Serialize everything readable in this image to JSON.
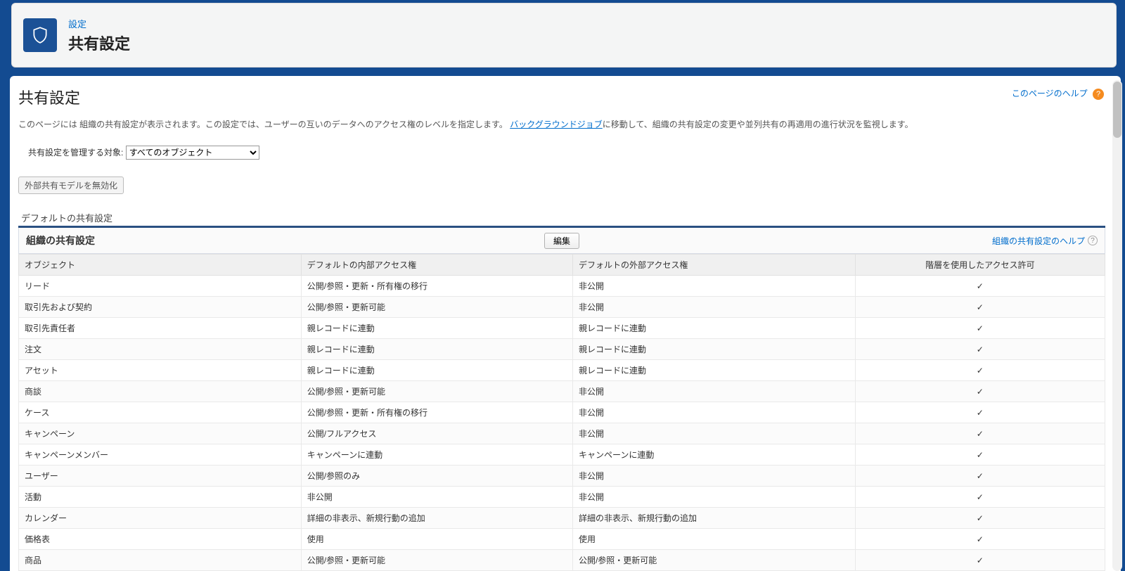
{
  "breadcrumb": "設定",
  "page_title": "共有設定",
  "content": {
    "heading": "共有設定",
    "help_link": "このページのヘルプ",
    "description_prefix": "このページには 組織の共有設定が表示されます。この設定では、ユーザーの互いのデータへのアクセス権のレベルを指定します。",
    "bg_jobs_link": "バックグラウンドジョブ",
    "description_suffix": "に移動して、組織の共有設定の変更や並列共有の再適用の進行状況を監視します。",
    "filter_label": "共有設定を管理する対象:",
    "filter_selected": "すべてのオブジェクト",
    "disable_button": "外部共有モデルを無効化",
    "section_label": "デフォルトの共有設定",
    "panel_title": "組織の共有設定",
    "edit_button": "編集",
    "panel_help": "組織の共有設定のヘルプ",
    "columns": {
      "object": "オブジェクト",
      "internal": "デフォルトの内部アクセス権",
      "external": "デフォルトの外部アクセス権",
      "hierarchy": "階層を使用したアクセス許可"
    },
    "rows": [
      {
        "object": "リード",
        "internal": "公開/参照・更新・所有権の移行",
        "external": "非公開",
        "hierarchy": "✓"
      },
      {
        "object": "取引先および契約",
        "internal": "公開/参照・更新可能",
        "external": "非公開",
        "hierarchy": "✓"
      },
      {
        "object": "取引先責任者",
        "internal": "親レコードに連動",
        "external": "親レコードに連動",
        "hierarchy": "✓"
      },
      {
        "object": "注文",
        "internal": "親レコードに連動",
        "external": "親レコードに連動",
        "hierarchy": "✓"
      },
      {
        "object": "アセット",
        "internal": "親レコードに連動",
        "external": "親レコードに連動",
        "hierarchy": "✓"
      },
      {
        "object": "商談",
        "internal": "公開/参照・更新可能",
        "external": "非公開",
        "hierarchy": "✓"
      },
      {
        "object": "ケース",
        "internal": "公開/参照・更新・所有権の移行",
        "external": "非公開",
        "hierarchy": "✓"
      },
      {
        "object": "キャンペーン",
        "internal": "公開/フルアクセス",
        "external": "非公開",
        "hierarchy": "✓"
      },
      {
        "object": "キャンペーンメンバー",
        "internal": "キャンペーンに連動",
        "external": "キャンペーンに連動",
        "hierarchy": "✓"
      },
      {
        "object": "ユーザー",
        "internal": "公開/参照のみ",
        "external": "非公開",
        "hierarchy": "✓"
      },
      {
        "object": "活動",
        "internal": "非公開",
        "external": "非公開",
        "hierarchy": "✓"
      },
      {
        "object": "カレンダー",
        "internal": "詳細の非表示、新規行動の追加",
        "external": "詳細の非表示、新規行動の追加",
        "hierarchy": "✓"
      },
      {
        "object": "価格表",
        "internal": "使用",
        "external": "使用",
        "hierarchy": "✓"
      },
      {
        "object": "商品",
        "internal": "公開/参照・更新可能",
        "external": "公開/参照・更新可能",
        "hierarchy": "✓"
      }
    ]
  }
}
